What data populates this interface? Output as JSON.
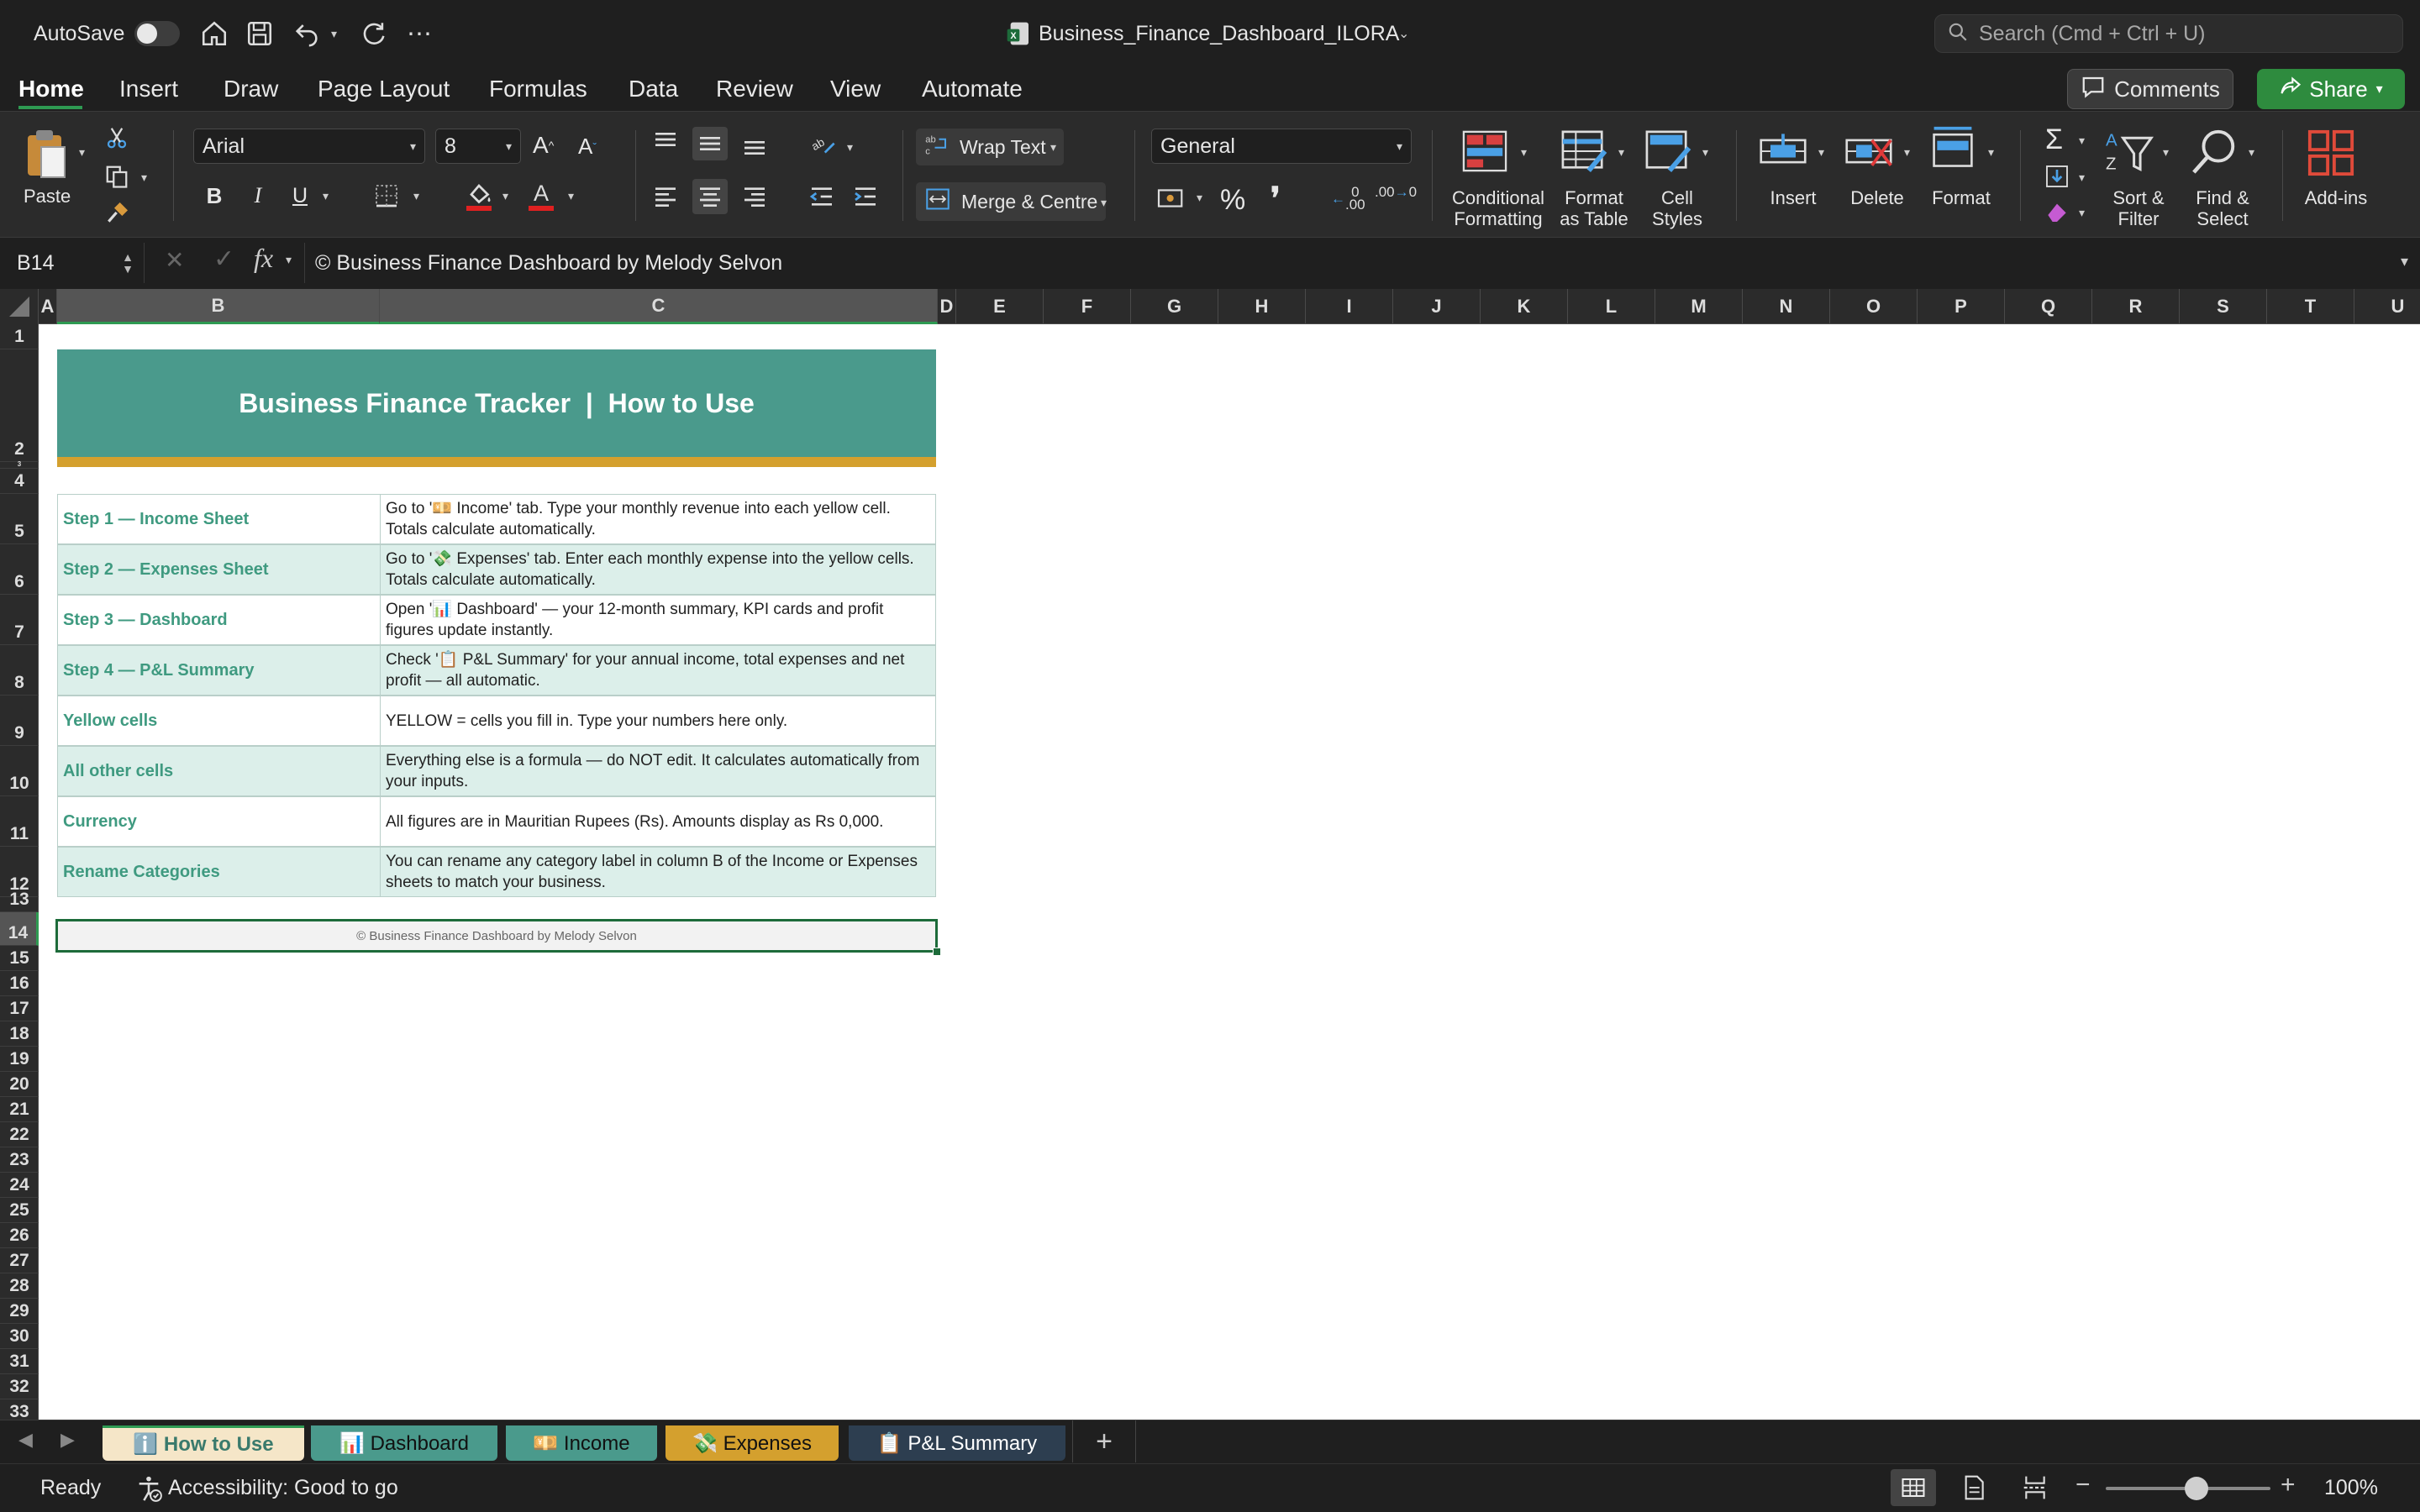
{
  "titlebar": {
    "autosave_label": "AutoSave",
    "file_name": "Business_Finance_Dashboard_ILORA",
    "search_placeholder": "Search (Cmd + Ctrl + U)"
  },
  "ribbon_tabs": [
    "Home",
    "Insert",
    "Draw",
    "Page Layout",
    "Formulas",
    "Data",
    "Review",
    "View",
    "Automate"
  ],
  "ribbon_right": {
    "comments": "Comments",
    "share": "Share"
  },
  "ribbon": {
    "paste": "Paste",
    "font_name": "Arial",
    "font_size": "8",
    "wrap_text": "Wrap Text",
    "merge_centre": "Merge & Centre",
    "number_format": "General",
    "conditional_formatting": [
      "Conditional",
      "Formatting"
    ],
    "format_as_table": [
      "Format",
      "as Table"
    ],
    "cell_styles": [
      "Cell",
      "Styles"
    ],
    "insert": "Insert",
    "delete": "Delete",
    "format": "Format",
    "sort_filter": [
      "Sort &",
      "Filter"
    ],
    "find_select": [
      "Find &",
      "Select"
    ],
    "addins": "Add-ins"
  },
  "formula_bar": {
    "name_box": "B14",
    "formula": "© Business Finance Dashboard by Melody Selvon"
  },
  "columns": [
    "A",
    "B",
    "C",
    "D",
    "E",
    "F",
    "G",
    "H",
    "I",
    "J",
    "K",
    "L",
    "M",
    "N",
    "O",
    "P",
    "Q",
    "R",
    "S",
    "T",
    "U"
  ],
  "rows": [
    "1",
    "2",
    "3",
    "4",
    "5",
    "6",
    "7",
    "8",
    "9",
    "10",
    "11",
    "12",
    "13",
    "14",
    "15",
    "16",
    "17",
    "18",
    "19",
    "20",
    "21",
    "22",
    "23",
    "24",
    "25",
    "26",
    "27",
    "28",
    "29",
    "30",
    "31",
    "32",
    "33"
  ],
  "sheet": {
    "banner_title": "Business Finance Tracker  |  How to Use",
    "steps": [
      {
        "label": "Step 1 — Income Sheet",
        "text": "Go to '💴 Income' tab. Type your monthly revenue into each yellow cell. Totals calculate automatically."
      },
      {
        "label": "Step 2 — Expenses Sheet",
        "text": "Go to '💸 Expenses' tab. Enter each monthly expense into the yellow cells. Totals calculate automatically."
      },
      {
        "label": "Step 3 — Dashboard",
        "text": "Open '📊 Dashboard' — your 12-month summary, KPI cards and profit figures update instantly."
      },
      {
        "label": "Step 4 — P&L Summary",
        "text": "Check '📋 P&L Summary' for your annual income, total expenses and net profit — all automatic."
      },
      {
        "label": "Yellow cells",
        "text": "YELLOW = cells you fill in. Type your numbers here only."
      },
      {
        "label": "All other cells",
        "text": "Everything else is a formula — do NOT edit. It calculates automatically from your inputs."
      },
      {
        "label": "Currency",
        "text": "All figures are in Mauritian Rupees (Rs). Amounts display as Rs 0,000."
      },
      {
        "label": "Rename Categories",
        "text": "You can rename any category label in column B of the Income or Expenses sheets to match your business."
      }
    ],
    "footer": "© Business Finance Dashboard by Melody Selvon"
  },
  "sheet_tabs": [
    {
      "label": "ℹ️ How to Use",
      "color": "#f5e6c8"
    },
    {
      "label": "📊 Dashboard",
      "color": "#4a9a8c"
    },
    {
      "label": "💴 Income",
      "color": "#4a9a8c"
    },
    {
      "label": "💸 Expenses",
      "color": "#d4a02e"
    },
    {
      "label": "📋 P&L Summary",
      "color": "#2d3e50"
    }
  ],
  "status": {
    "ready": "Ready",
    "accessibility": "Accessibility: Good to go",
    "zoom": "100%",
    "zoom_level": 0.55
  },
  "colors": {
    "teal": "#4a9a8c",
    "gold": "#d4a02e",
    "label_teal": "#3f9a80",
    "row_alt": "#dcefea",
    "share_green": "#2e8b3e",
    "excel_green": "#1d6b3a"
  }
}
